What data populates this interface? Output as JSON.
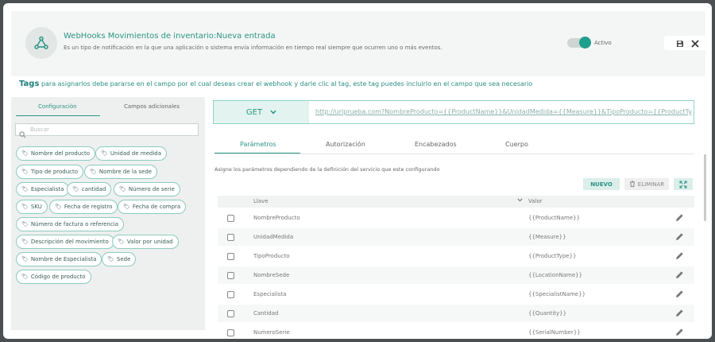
{
  "header": {
    "title": "WebHooks Movimientos de inventario:Nueva entrada",
    "description": "Es un tipo de notificación en la que una aplicación o sistema envía información en tiempo real siempre que ocurren uno o más eventos.",
    "toggle_label": "Activo",
    "toggle_on": true,
    "icons": {
      "webhook": "webhook-icon",
      "save": "save-icon",
      "close": "close-icon"
    }
  },
  "tags_info": {
    "label": "Tags",
    "text": "para asignarlos debe pararse en el campo por el cual deseas crear el webhook y darle clic al tag, este tag puedes incluirlo en el campo que sea necesario"
  },
  "left_panel": {
    "tabs": [
      {
        "label": "Configuración",
        "active": true
      },
      {
        "label": "Campos adicionales",
        "active": false
      }
    ],
    "search_placeholder": "Buscar",
    "tags": [
      "Nombre del producto",
      "Unidad de medida",
      "Tipo de producto",
      "Nombre de la sede",
      "Especialista",
      "cantidad",
      "Número de serie",
      "SKU",
      "Fecha de registro",
      "Fecha de compra",
      "Número de factura o referencia",
      "Descripción del movimiento",
      "Valor por unidad",
      "Nombre de Especialista",
      "Sede",
      "Código de producto"
    ]
  },
  "request": {
    "method": "GET",
    "url": "http://urlprueba.com?NombreProducto={{ProductName}}&UnidadMedida={{Measure}}&TipoProducto={{ProductType}}&",
    "tabs": [
      {
        "label": "Parámetros",
        "active": true
      },
      {
        "label": "Autorización",
        "active": false
      },
      {
        "label": "Encabezados",
        "active": false
      },
      {
        "label": "Cuerpo",
        "active": false
      }
    ],
    "assign_text": "Asigne los parámetros dependiendo de la definición del servicio que este configurando",
    "buttons": {
      "new": "NUEVO",
      "delete": "ELIMINAR"
    },
    "columns": {
      "key": "Llave",
      "value": "Valor"
    },
    "params": [
      {
        "key": "NombreProducto",
        "value": "{{ProductName}}"
      },
      {
        "key": "UnidadMedida",
        "value": "{{Measure}}"
      },
      {
        "key": "TipoProducto",
        "value": "{{ProductType}}"
      },
      {
        "key": "NombreSede",
        "value": "{{LocationName}}"
      },
      {
        "key": "Especialista",
        "value": "{{SpecialistName}}"
      },
      {
        "key": "Cantidad",
        "value": "{{Quantity}}"
      },
      {
        "key": "NumeroSerie",
        "value": "{{SerialNumber}}"
      }
    ]
  },
  "colors": {
    "accent": "#2a9485",
    "toggle": "#1fa08d",
    "tag_border": "#8ccbbf"
  }
}
